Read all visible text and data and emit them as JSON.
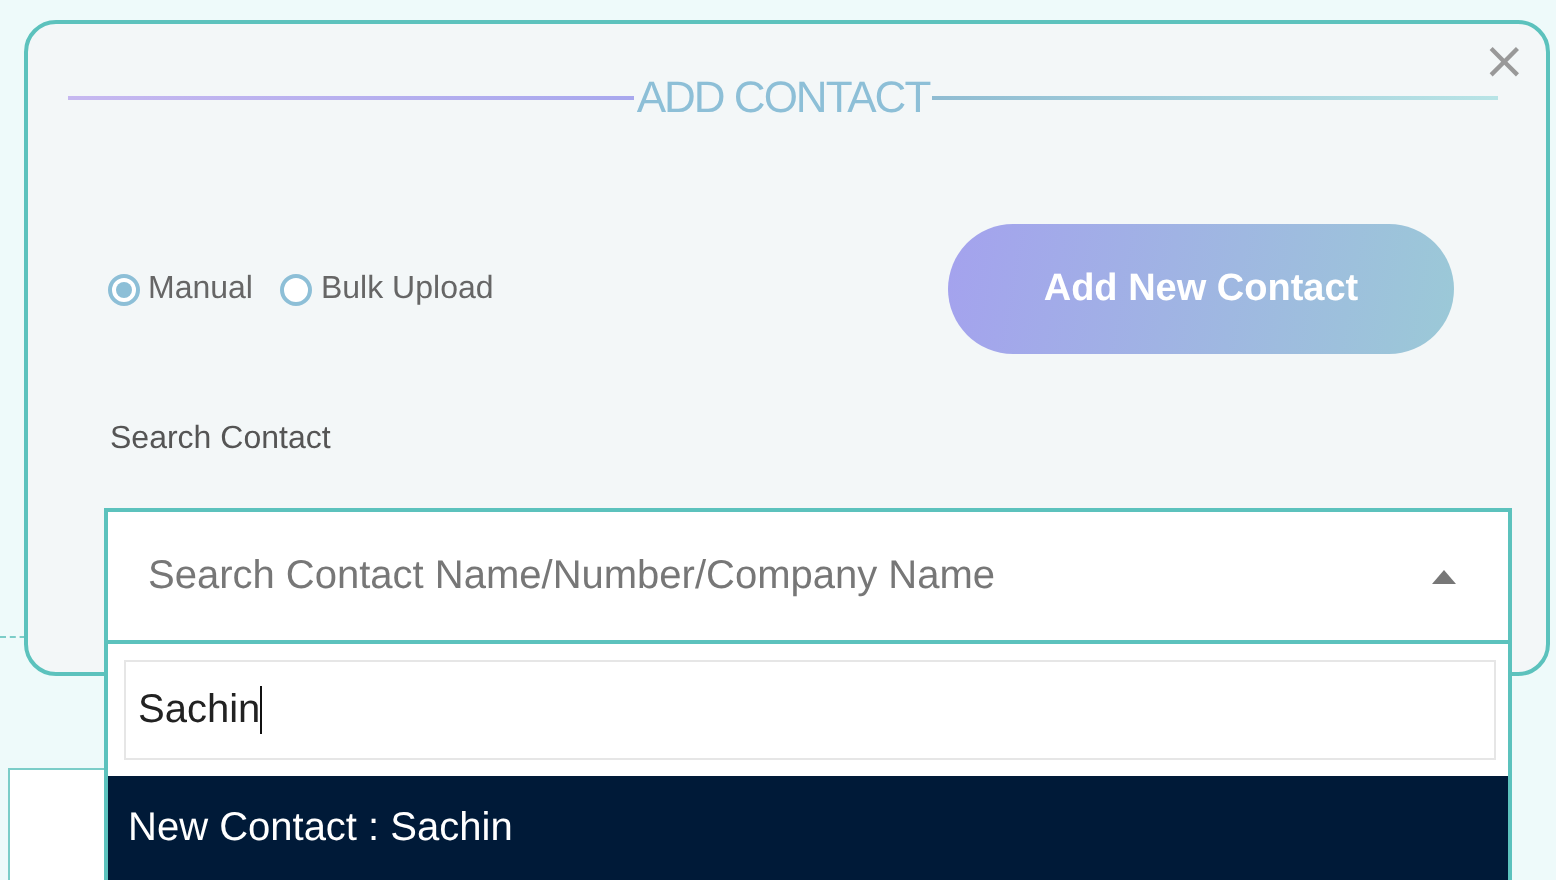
{
  "dialog": {
    "title": "ADD CONTACT",
    "close": "×"
  },
  "mode_options": [
    {
      "label": "Manual",
      "selected": true
    },
    {
      "label": "Bulk Upload",
      "selected": false
    }
  ],
  "add_button": "Add New Contact",
  "search_label": "Search Contact",
  "contact_select": {
    "placeholder": "Search Contact Name/Number/Company Name",
    "expanded": true,
    "filter_value": "Sachin",
    "options": [
      {
        "label": "New Contact : Sachin",
        "selected": true
      }
    ]
  }
}
